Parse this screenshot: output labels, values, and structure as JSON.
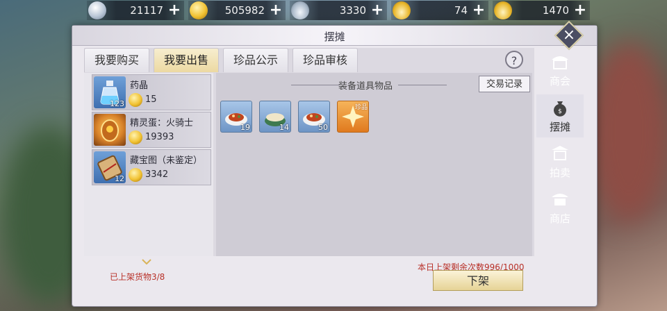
{
  "currencies": [
    {
      "icon": "silver-coin-icon",
      "value": "21117"
    },
    {
      "icon": "gold-coin-icon",
      "value": "505982"
    },
    {
      "icon": "silver-ingot-icon",
      "value": "3330"
    },
    {
      "icon": "gold-ingot-icon",
      "value": "74"
    },
    {
      "icon": "gold-ingot-icon",
      "value": "1470"
    }
  ],
  "window": {
    "title": "摆摊"
  },
  "tabs": [
    "我要购买",
    "我要出售",
    "珍品公示",
    "珍品审核"
  ],
  "active_tab": 1,
  "help_label": "?",
  "listing": [
    {
      "name": "药晶",
      "price": "15",
      "qty": "123",
      "icon": "potion-bottle-icon"
    },
    {
      "name": "精灵蛋：火骑士",
      "price": "19393",
      "qty": "",
      "icon": "fire-egg-icon"
    },
    {
      "name": "藏宝图（未鉴定）",
      "price": "3342",
      "qty": "12",
      "icon": "treasure-map-icon"
    }
  ],
  "bag": {
    "title": "装备道具物品",
    "record_label": "交易记录",
    "slots": [
      {
        "icon": "food-dish-icon",
        "qty": "19"
      },
      {
        "icon": "soup-bowl-icon",
        "qty": "14"
      },
      {
        "icon": "food-dish-icon",
        "qty": "50"
      },
      {
        "icon": "rare-gem-icon",
        "qty": "",
        "tag": "珍品"
      }
    ]
  },
  "footer": {
    "listed": "已上架货物3/8",
    "remain": "本日上架剩余次数996/1000",
    "delist_label": "下架"
  },
  "nav": [
    "商会",
    "摆摊",
    "拍卖",
    "商店"
  ],
  "colors": {
    "accent_red": "#b83028",
    "tab_active": "#ecd9a2",
    "nav_active": "#e1dee8"
  }
}
